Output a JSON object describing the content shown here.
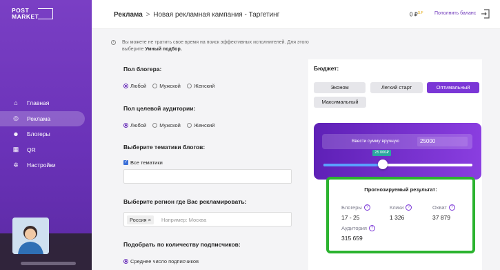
{
  "logo": {
    "line1": "POST",
    "line2": "MARKET"
  },
  "sidebar": {
    "items": [
      {
        "label": "Главная",
        "icon": "home-icon"
      },
      {
        "label": "Реклама",
        "icon": "target-icon"
      },
      {
        "label": "Блогеры",
        "icon": "users-icon"
      },
      {
        "label": "QR",
        "icon": "qr-icon"
      },
      {
        "label": "Настройки",
        "icon": "gear-icon"
      }
    ]
  },
  "header": {
    "crumb_root": "Реклама",
    "crumb_sep": ">",
    "crumb_page": "Новая рекламная кампания - Таргетинг",
    "balance": "0 ₽",
    "balance_sup": "S.F",
    "topup": "Пополнить баланс"
  },
  "form": {
    "hint_text": "Вы можете не тратить свое время на поиск эффективных исполнителей. Для этого выберите",
    "hint_bold": "Умный подбор.",
    "blogger_gender_label": "Пол блогера:",
    "audience_gender_label": "Пол целевой аудитории:",
    "gender_options": [
      "Любой",
      "Мужской",
      "Женский"
    ],
    "topics_label": "Выберите тематики блогов:",
    "all_topics": "Все тематики",
    "region_label": "Выберите регион где Вас рекламировать:",
    "region_tag": "Россия ×",
    "region_placeholder": "Например: Москва",
    "subscribers_label": "Подобрать по количеству подписчиков:",
    "subscribers_option": "Среднее число подписчиков"
  },
  "budget": {
    "title": "Бюджет:",
    "options": [
      "Эконом",
      "Легкий старт",
      "Оптимальный",
      "Максимальный"
    ],
    "active": "Оптимальный",
    "manual_label": "Ввести сумму вручную",
    "manual_value": "25000",
    "slider_tip": "25 000₽",
    "slider_fraction": 0.4
  },
  "result": {
    "title": "Прогнозируемый результат:",
    "stats": [
      {
        "label": "Блогеры",
        "value": "17 - 25"
      },
      {
        "label": "Клики",
        "value": "1 326"
      },
      {
        "label": "Охват",
        "value": "37 879"
      },
      {
        "label": "Аудитория",
        "value": "315 659"
      }
    ]
  },
  "colors": {
    "accent": "#7a36d6",
    "highlight": "#2bb32f"
  }
}
